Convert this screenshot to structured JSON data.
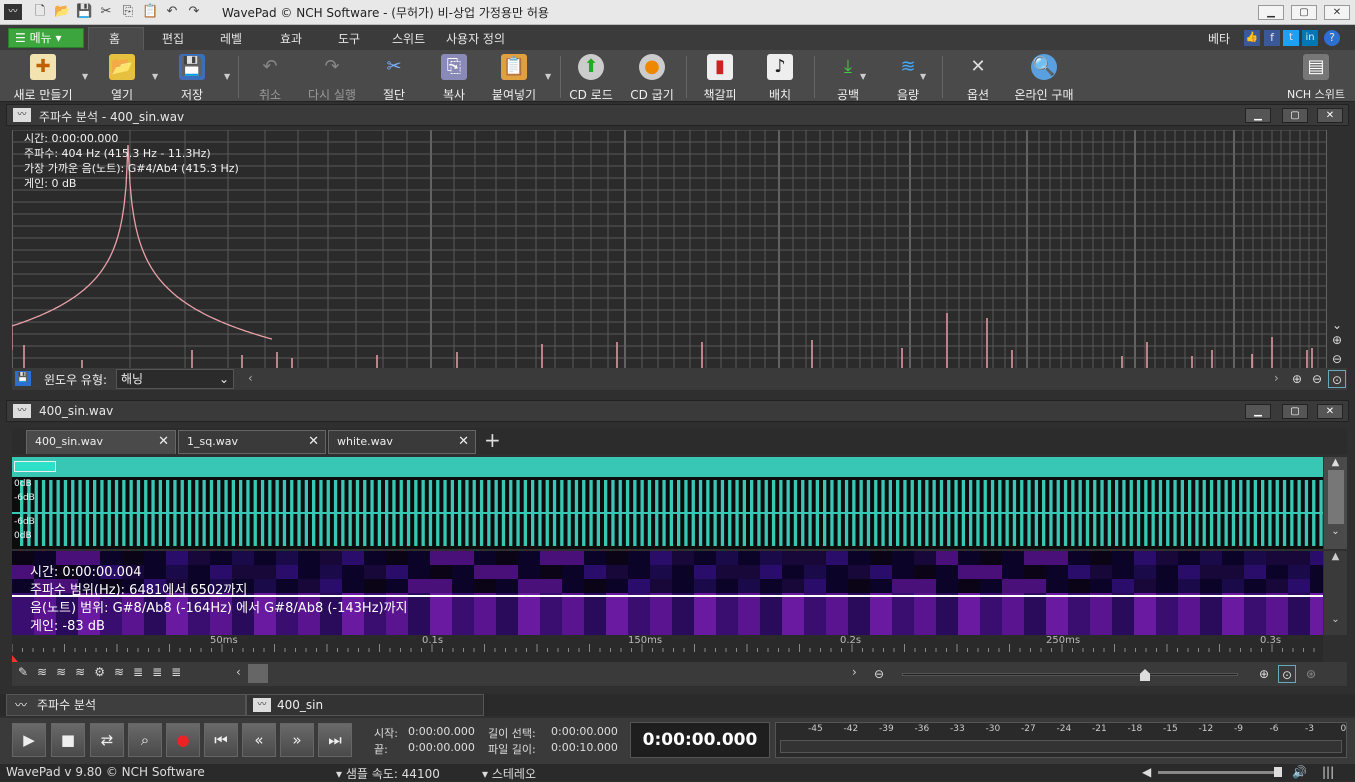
{
  "window": {
    "title": "WavePad © NCH Software - (무허가) 비-상업 가정용만 허용"
  },
  "menu": {
    "menu_button": "메뉴",
    "tabs": [
      "홈",
      "편집",
      "레벨",
      "효과",
      "도구",
      "스위트",
      "사용자 정의"
    ],
    "beta": "베타"
  },
  "ribbon": {
    "new": "새로 만들기",
    "open": "열기",
    "save": "저장",
    "undo": "취소",
    "redo": "다시 실행",
    "cut": "절단",
    "copy": "복사",
    "paste": "붙여넣기",
    "cd_load": "CD 로드",
    "cd_burn": "CD 굽기",
    "bookmark": "책갈피",
    "batch": "배치",
    "silence": "공백",
    "volume": "음량",
    "options": "옵션",
    "buy": "온라인 구매",
    "nch": "NCH 스위트"
  },
  "freq_panel": {
    "title": "주파수 분석 - 400_sin.wav",
    "time": "시간: 0:00:00.000",
    "freq": "주파수: 404 Hz (415.3 Hz - 11.3Hz)",
    "note": "가장 가까운 음(노트): G#4/Ab4 (415.3 Hz)",
    "gain": "게인: 0 dB",
    "window_label": "윈도우 유형:",
    "window_value": "해닝"
  },
  "wave_panel": {
    "title": "400_sin.wav",
    "tabs": [
      {
        "label": "400_sin.wav"
      },
      {
        "label": "1_sq.wav"
      },
      {
        "label": "white.wav"
      }
    ],
    "db_labels": [
      "0dB",
      "-6dB",
      "-6dB",
      "0dB"
    ],
    "spectro_time": "시간: 0:00:00.004",
    "spectro_range": "주파수 범위(Hz): 6481에서 6502까지",
    "spectro_note": "음(노트) 범위: G#8/Ab8  (-164Hz) 에서 G#8/Ab8  (-143Hz)까지",
    "spectro_gain": "게인: -83 dB",
    "ruler": [
      "50ms",
      "0.1s",
      "150ms",
      "0.2s",
      "250ms",
      "0.3s"
    ]
  },
  "bottom_tabs": [
    "주파수 분석",
    "400_sin"
  ],
  "transport": {
    "start_label": "시작:",
    "start": "0:00:00.000",
    "end_label": "끝:",
    "end": "0:00:00.000",
    "sel_label": "길이 선택:",
    "sel": "0:00:00.000",
    "file_label": "파일 길이:",
    "file": "0:00:10.000",
    "time": "0:00:00.000"
  },
  "meter": [
    "-45",
    "-42",
    "-39",
    "-36",
    "-33",
    "-30",
    "-27",
    "-24",
    "-21",
    "-18",
    "-15",
    "-12",
    "-9",
    "-6",
    "-3",
    "0"
  ],
  "status": {
    "version": "WavePad v 9.80 © NCH Software",
    "rate": "샘플 속도: 44100",
    "channels": "스테레오"
  },
  "colors": {
    "accent": "#3da53d",
    "wave": "#37c7b4",
    "spectrum_line": "#e8a0a8"
  }
}
